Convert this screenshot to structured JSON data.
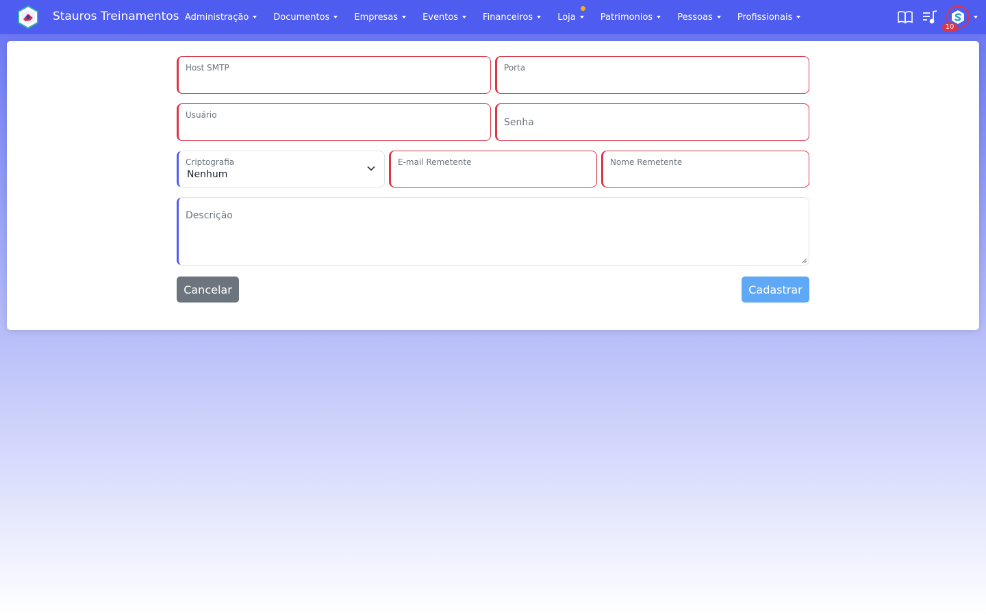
{
  "brand": {
    "name": "Stauros Treinamentos"
  },
  "nav": {
    "items": [
      {
        "label": "Administração"
      },
      {
        "label": "Documentos"
      },
      {
        "label": "Empresas"
      },
      {
        "label": "Eventos"
      },
      {
        "label": "Financeiros"
      },
      {
        "label": "Loja"
      },
      {
        "label": "Patrimonios"
      },
      {
        "label": "Pessoas"
      },
      {
        "label": "Profissionais"
      }
    ]
  },
  "user": {
    "badge_count": "10"
  },
  "form": {
    "host": {
      "label": "Host SMTP",
      "value": ""
    },
    "port": {
      "label": "Porta",
      "value": ""
    },
    "user": {
      "label": "Usuário",
      "value": ""
    },
    "password": {
      "placeholder": "Senha",
      "value": ""
    },
    "encryption": {
      "label": "Criptografia",
      "selected": "Nenhum"
    },
    "sender_email": {
      "label": "E-mail Remetente",
      "value": ""
    },
    "sender_name": {
      "label": "Nome Remetente",
      "value": ""
    },
    "description": {
      "placeholder": "Descrição",
      "value": ""
    },
    "cancel_label": "Cancelar",
    "submit_label": "Cadastrar"
  },
  "colors": {
    "primary": "#4f5cf0",
    "invalid": "#dc3545",
    "secondary": "#6c757d",
    "submit": "#5ea8f5",
    "notification_dot": "#f5b014"
  }
}
